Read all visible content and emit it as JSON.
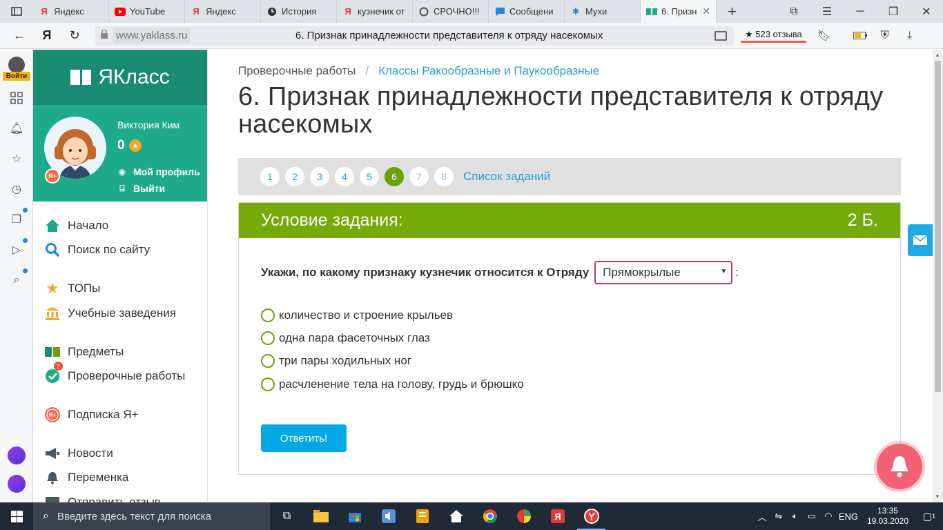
{
  "browser": {
    "tabs": [
      {
        "title": "Яндекс",
        "icon": "yandex-icon",
        "color": "#e53935"
      },
      {
        "title": "YouTube",
        "icon": "youtube-icon",
        "color": "#ff0000"
      },
      {
        "title": "Яндекс",
        "icon": "yandex-icon",
        "color": "#e53935"
      },
      {
        "title": "История",
        "icon": "clock-icon",
        "color": "#333333"
      },
      {
        "title": "кузнечик от",
        "icon": "yandex-icon",
        "color": "#e53935"
      },
      {
        "title": "СРОЧНО!!!",
        "icon": "circle-icon",
        "color": "#555555"
      },
      {
        "title": "Сообщени",
        "icon": "chat-icon",
        "color": "#1e88e5"
      },
      {
        "title": "Мухи",
        "icon": "bluetooth-icon",
        "color": "#1e88e5"
      },
      {
        "title": "6. Призн",
        "icon": "book-icon",
        "color": "#1fab8b",
        "active": true
      }
    ],
    "url_host": "www.yaklass.ru",
    "page_title": "6. Признак принадлежности представителя к отряду насекомых",
    "reviews": "★ 523 отзыва"
  },
  "rail": {
    "login_label": "Войти"
  },
  "sidebar": {
    "logo_text": "ЯКласс",
    "user_name": "Виктория Ким",
    "points": "0",
    "badge_text": "Я+",
    "my_profile": "Мой профиль",
    "logout": "Выйти",
    "nav": [
      {
        "label": "Начало",
        "icon": "home-icon"
      },
      {
        "label": "Поиск по сайту",
        "icon": "search-icon"
      },
      {
        "label": "ТОПы",
        "icon": "star-icon"
      },
      {
        "label": "Учебные заведения",
        "icon": "institution-icon"
      },
      {
        "label": "Предметы",
        "icon": "books-icon"
      },
      {
        "label": "Проверочные работы",
        "icon": "test-icon",
        "badge": "2"
      },
      {
        "label": "Подписка Я+",
        "icon": "subscription-icon"
      },
      {
        "label": "Новости",
        "icon": "megaphone-icon"
      },
      {
        "label": "Переменка",
        "icon": "bell-icon"
      },
      {
        "label": "Отправить отзыв",
        "icon": "feedback-icon"
      }
    ]
  },
  "main": {
    "breadcrumb": {
      "first": "Проверочные работы",
      "sep": "/",
      "second": "Классы Ракообразные и Паукообразные"
    },
    "title": "6. Признак принадлежности представителя к отряду насекомых",
    "steps": [
      "1",
      "2",
      "3",
      "4",
      "5",
      "6",
      "7",
      "8"
    ],
    "current_step": "6",
    "task_list": "Список заданий",
    "card": {
      "header": "Условие задания:",
      "points": "2 Б.",
      "question": "Укажи, по какому признаку кузнечик относится к Отряду",
      "select_value": "Прямокрылые",
      "colon": ":",
      "options": [
        "количество и строение крыльев",
        "одна пара фасеточных глаз",
        "три пары ходильных ног",
        "расчленение тела на голову, грудь и брюшко"
      ],
      "submit": "Ответить!"
    }
  },
  "taskbar": {
    "search_placeholder": "Введите здесь текст для поиска",
    "lang": "ENG",
    "time": "13:35",
    "date": "19.03.2020",
    "notif_count": "1"
  },
  "colors": {
    "accent_green": "#76aa08",
    "teal": "#1fab8b",
    "link_blue": "#2b9bd7",
    "button_blue": "#03a9e6"
  }
}
